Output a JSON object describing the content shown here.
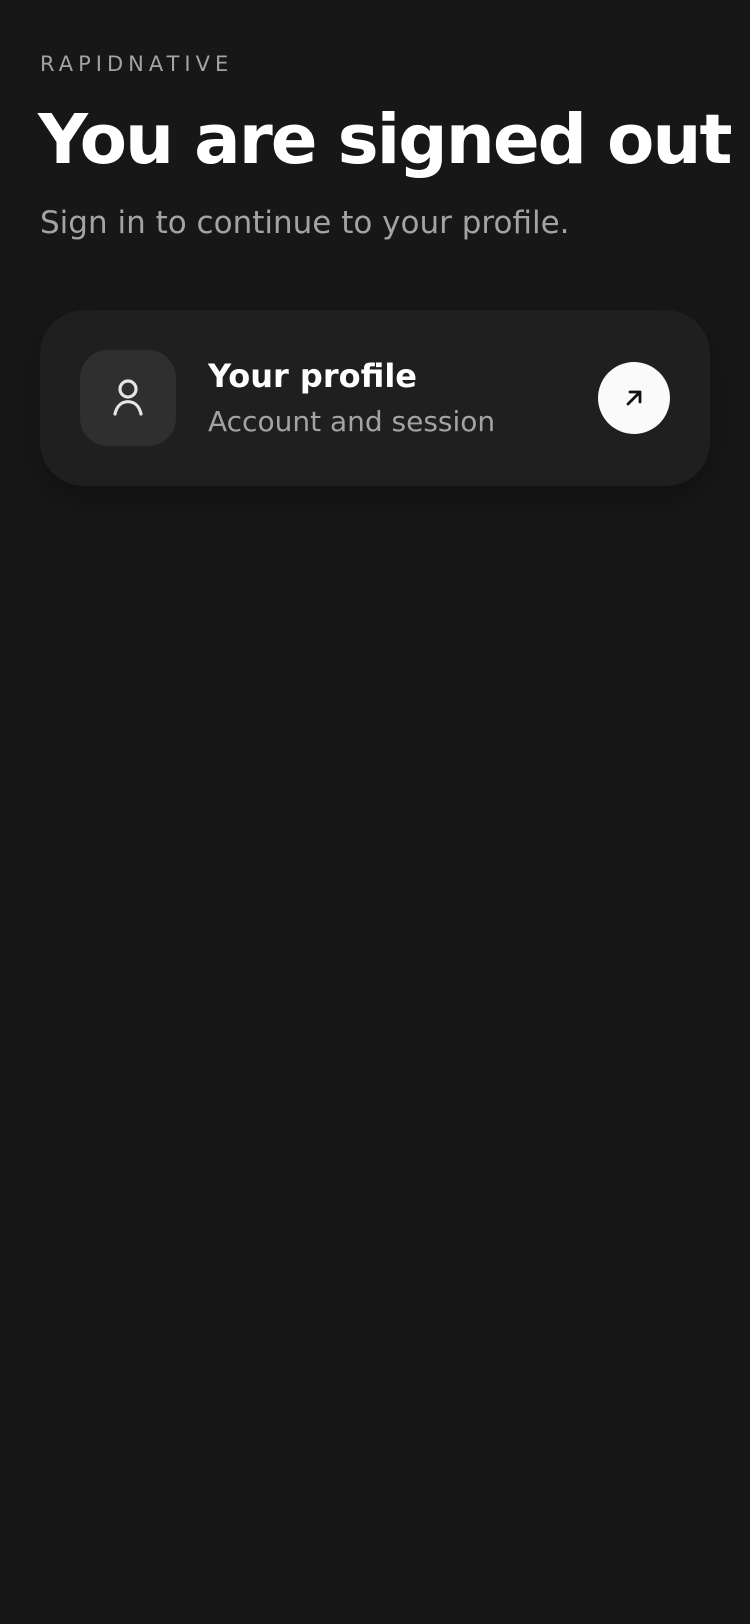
{
  "header": {
    "brand": "RAPIDNATIVE",
    "title": "You are signed out",
    "subtitle": "Sign in to continue to your profile."
  },
  "profile_card": {
    "title": "Your profile",
    "subtitle": "Account and session",
    "icon": "user-icon",
    "action_icon": "arrow-up-right-icon"
  },
  "colors": {
    "background": "#171717",
    "card": "#1f1f1f",
    "icon_tile": "#2f2f2f",
    "muted_text": "#a3a3a3",
    "primary_text": "#ffffff",
    "action_button": "#fafafa"
  }
}
